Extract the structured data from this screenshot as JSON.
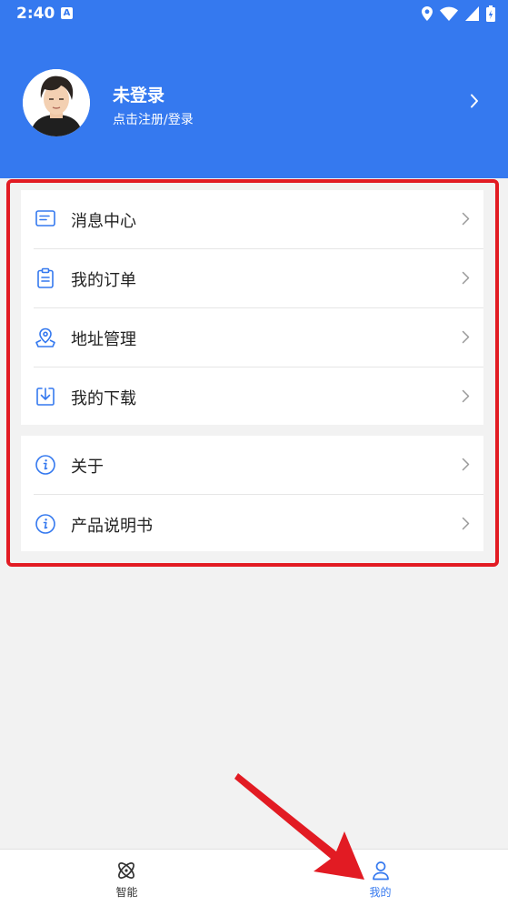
{
  "status_bar": {
    "time": "2:40",
    "notification_badge": "A",
    "icons": [
      "location-icon",
      "wifi-icon",
      "signal-icon",
      "battery-icon"
    ]
  },
  "profile": {
    "name": "未登录",
    "subtitle": "点击注册/登录"
  },
  "menu": {
    "items": [
      {
        "label": "消息中心",
        "icon": "message-icon"
      },
      {
        "label": "我的订单",
        "icon": "clipboard-icon"
      },
      {
        "label": "地址管理",
        "icon": "map-pin-icon"
      },
      {
        "label": "我的下载",
        "icon": "download-icon"
      },
      {
        "label": "关于",
        "icon": "info-icon"
      },
      {
        "label": "产品说明书",
        "icon": "info-icon"
      }
    ]
  },
  "tabbar": {
    "tabs": [
      {
        "label": "智能",
        "icon": "atom-icon",
        "active": false
      },
      {
        "label": "我的",
        "icon": "user-icon",
        "active": true
      }
    ]
  },
  "colors": {
    "brand_blue": "#3579ef",
    "highlight_red": "#e21b23",
    "inactive_tab": "#333333"
  }
}
